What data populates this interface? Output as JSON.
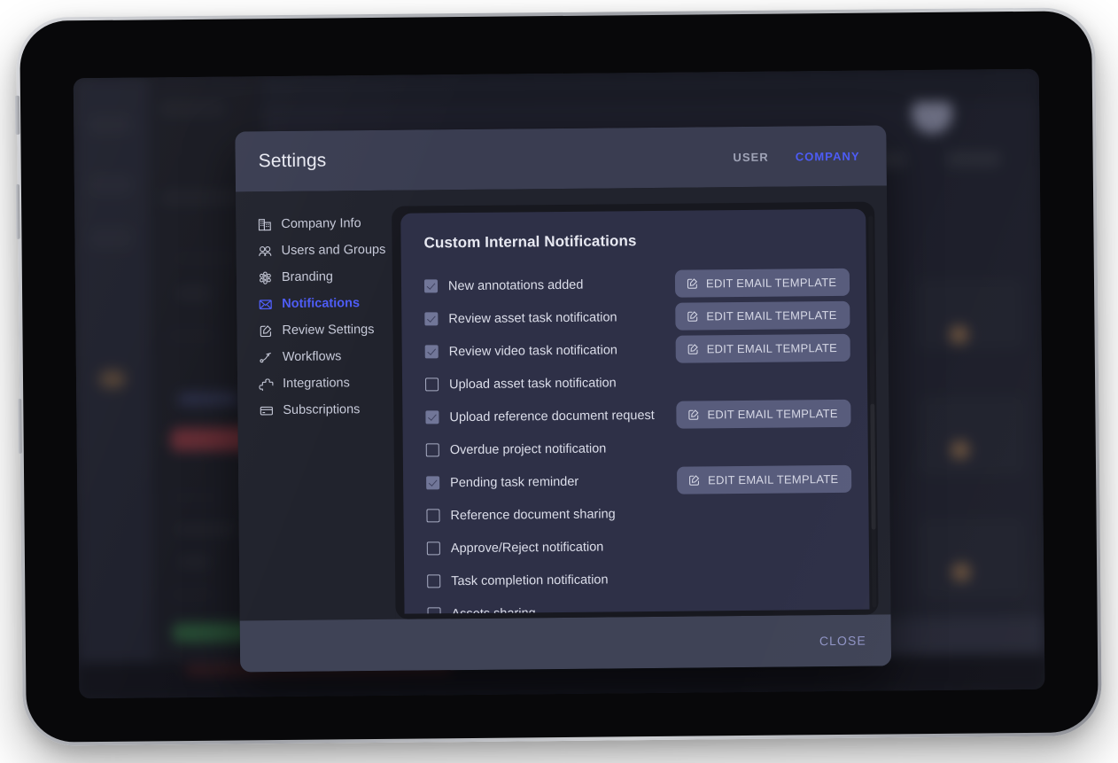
{
  "device": {
    "type": "tablet"
  },
  "modal": {
    "title": "Settings",
    "tabs": [
      {
        "label": "USER",
        "active": false
      },
      {
        "label": "COMPANY",
        "active": true
      }
    ],
    "close_label": "CLOSE",
    "accent_color": "#4d5cf6",
    "header_bg": "#3a3d51",
    "footer_bg": "#3f4356",
    "body_bg": "#21232d",
    "panel_bg": "#2e3047"
  },
  "sidebar": {
    "items": [
      {
        "label": "Company Info",
        "icon": "building-icon",
        "active": false
      },
      {
        "label": "Users and Groups",
        "icon": "users-icon",
        "active": false
      },
      {
        "label": "Branding",
        "icon": "branding-icon",
        "active": false
      },
      {
        "label": "Notifications",
        "icon": "envelope-icon",
        "active": true
      },
      {
        "label": "Review Settings",
        "icon": "edit-square-icon",
        "active": false
      },
      {
        "label": "Workflows",
        "icon": "workflow-arrow-icon",
        "active": false
      },
      {
        "label": "Integrations",
        "icon": "puzzle-icon",
        "active": false
      },
      {
        "label": "Subscriptions",
        "icon": "card-icon",
        "active": false
      }
    ]
  },
  "panel": {
    "title": "Custom Internal Notifications",
    "template_button_label": "EDIT EMAIL TEMPLATE",
    "template_button_icon": "edit-square-icon",
    "rows": [
      {
        "label": "New annotations added",
        "checked": true,
        "has_template_button": true
      },
      {
        "label": "Review asset task notification",
        "checked": true,
        "has_template_button": true
      },
      {
        "label": "Review video task notification",
        "checked": true,
        "has_template_button": true
      },
      {
        "label": "Upload asset task notification",
        "checked": false,
        "has_template_button": false
      },
      {
        "label": "Upload reference document request",
        "checked": true,
        "has_template_button": true
      },
      {
        "label": "Overdue project notification",
        "checked": false,
        "has_template_button": false
      },
      {
        "label": "Pending task reminder",
        "checked": true,
        "has_template_button": true
      },
      {
        "label": "Reference document sharing",
        "checked": false,
        "has_template_button": false
      },
      {
        "label": "Approve/Reject notification",
        "checked": false,
        "has_template_button": false
      },
      {
        "label": "Task completion notification",
        "checked": false,
        "has_template_button": false
      },
      {
        "label": "Assets sharing",
        "checked": false,
        "has_template_button": false
      }
    ]
  }
}
